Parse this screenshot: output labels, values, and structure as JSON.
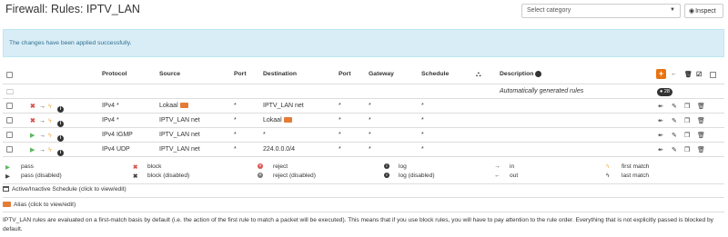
{
  "page": {
    "title": "Firewall: Rules: IPTV_LAN",
    "category_placeholder": "Select category",
    "inspect_label": "Inspect",
    "alert": "The changes have been applied successfully."
  },
  "table": {
    "headers": {
      "protocol": "Protocol",
      "source": "Source",
      "port1": "Port",
      "destination": "Destination",
      "port2": "Port",
      "gateway": "Gateway",
      "schedule": "Schedule",
      "description": "Description"
    },
    "auto_rules_label": "Automatically generated rules",
    "auto_rules_count": "28",
    "rows": [
      {
        "protocol": "IPv4 *",
        "source": "Lokaal",
        "source_alias": true,
        "port1": "*",
        "destination": "IPTV_LAN net",
        "dest_alias": false,
        "port2": "*",
        "gateway": "*",
        "schedule": "*",
        "action": "block"
      },
      {
        "protocol": "IPv4 *",
        "source": "IPTV_LAN net",
        "source_alias": false,
        "port1": "*",
        "destination": "Lokaal",
        "dest_alias": true,
        "port2": "*",
        "gateway": "*",
        "schedule": "*",
        "action": "block"
      },
      {
        "protocol": "IPv4 IGMP",
        "source": "IPTV_LAN net",
        "source_alias": false,
        "port1": "*",
        "destination": "*",
        "dest_alias": false,
        "port2": "*",
        "gateway": "*",
        "schedule": "*",
        "action": "pass"
      },
      {
        "protocol": "IPv4 UDP",
        "source": "IPTV_LAN net",
        "source_alias": false,
        "port1": "*",
        "destination": "224.0.0.0/4",
        "dest_alias": false,
        "port2": "*",
        "gateway": "*",
        "schedule": "*",
        "action": "pass"
      }
    ]
  },
  "legend": {
    "pass": "pass",
    "pass_disabled": "pass (disabled)",
    "block": "block",
    "block_disabled": "block (disabled)",
    "reject": "reject",
    "reject_disabled": "reject (disabled)",
    "log": "log",
    "log_disabled": "log (disabled)",
    "in": "in",
    "out": "out",
    "first_match": "first match",
    "last_match": "last match"
  },
  "schedule_note": "Active/Inactive Schedule (click to view/edit)",
  "alias_note": "Alias (click to view/edit)",
  "footer": "IPTV_LAN rules are evaluated on a first-match basis by default (i.e. the action of the first rule to match a packet will be executed). This means that if you use block rules, you will have to pay attention to the rule order. Everything that is not explicitly passed is blocked by default.",
  "colors": {
    "accent": "#e8730f",
    "alert_bg": "#d9edf7",
    "block": "#d9534f",
    "pass": "#5cb85c"
  }
}
